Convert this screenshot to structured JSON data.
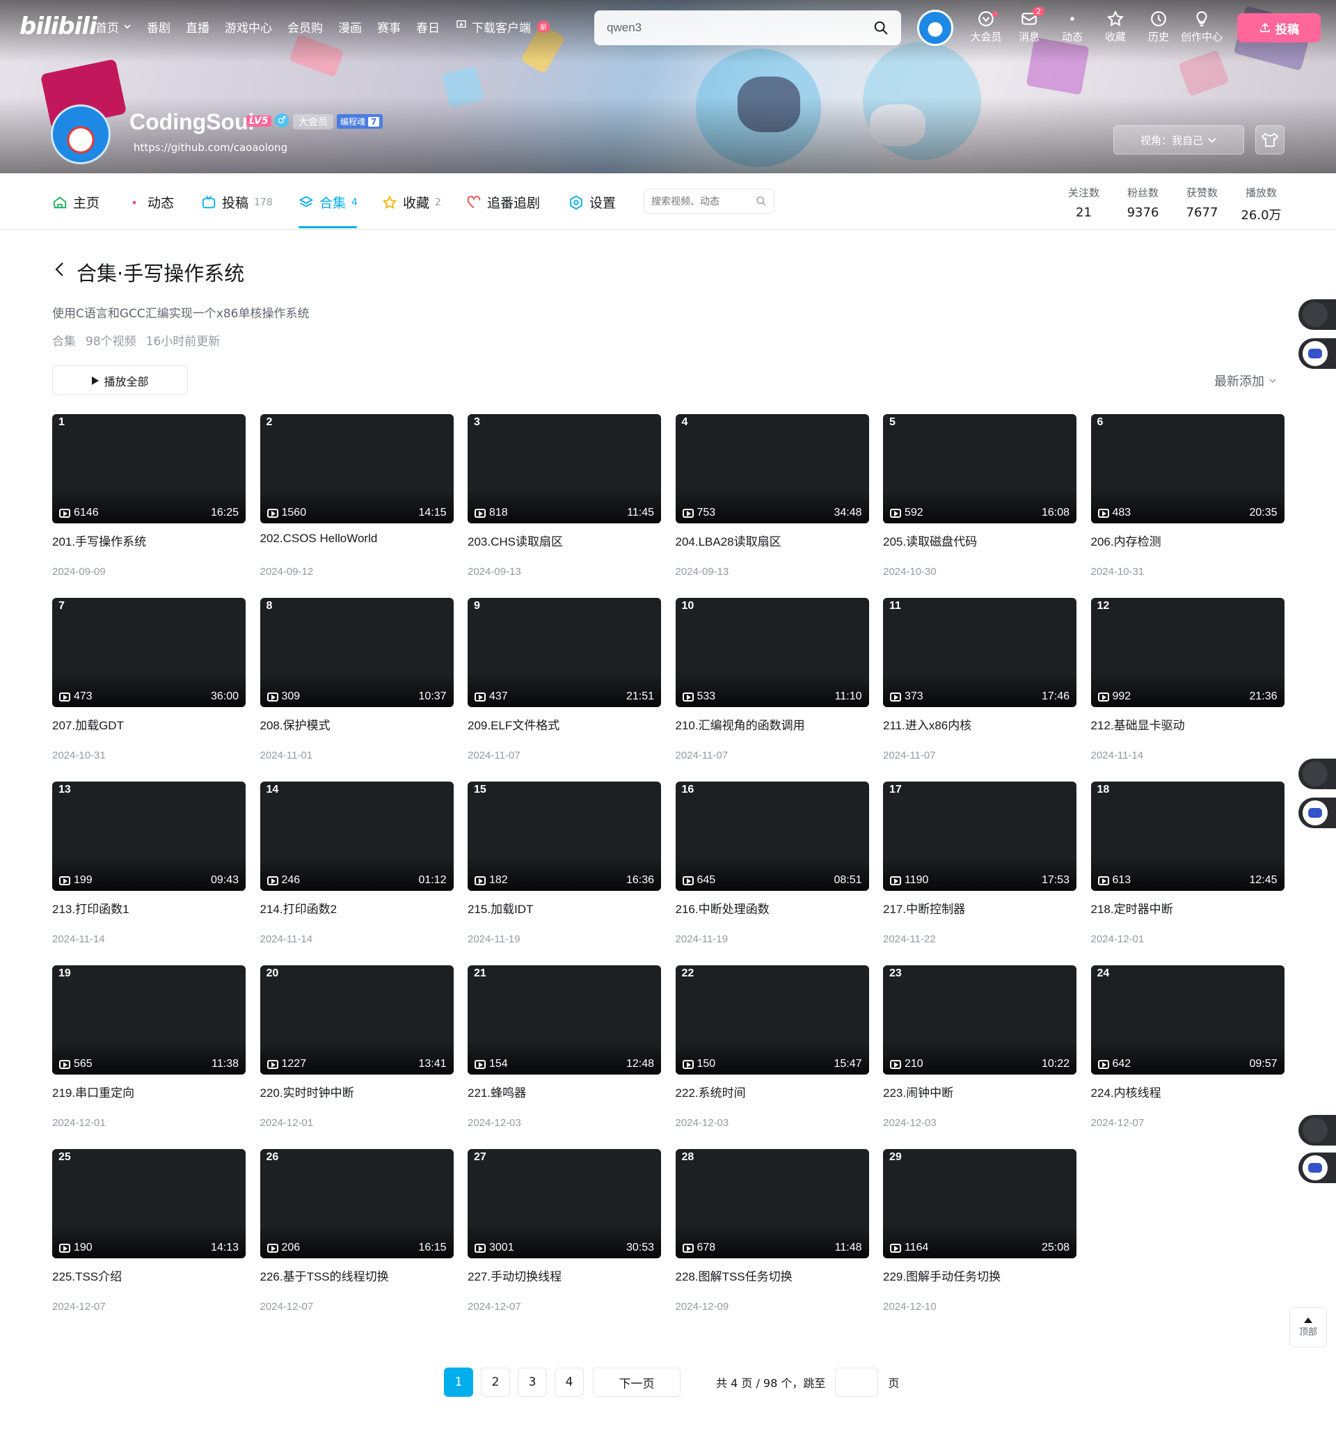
{
  "header": {
    "logo": "bilibili",
    "nav": [
      {
        "label": "首页",
        "has_chevron": true
      },
      {
        "label": "番剧"
      },
      {
        "label": "直播"
      },
      {
        "label": "游戏中心"
      },
      {
        "label": "会员购"
      },
      {
        "label": "漫画"
      },
      {
        "label": "赛事"
      },
      {
        "label": "春日"
      },
      {
        "label": "下载客户端",
        "badge": "新"
      }
    ],
    "search_value": "qwen3",
    "right": [
      {
        "label": "大会员",
        "icon": "vip-icon",
        "dot": true
      },
      {
        "label": "消息",
        "icon": "message-icon",
        "badge": "2"
      },
      {
        "label": "动态",
        "icon": "dynamic-icon"
      },
      {
        "label": "收藏",
        "icon": "star-icon"
      },
      {
        "label": "历史",
        "icon": "clock-icon"
      },
      {
        "label": "创作中心",
        "icon": "bulb-icon"
      }
    ],
    "upload_label": "投稿"
  },
  "profile": {
    "name": "CodingSoul",
    "level": "LV5",
    "vip": "大会员",
    "fan_badge": "编程魂",
    "fan_level": "7",
    "sign": "https://github.com/caoaolong",
    "view_as": "视角：我自己"
  },
  "tabs": [
    {
      "label": "主页",
      "count": "",
      "icon": "home-icon"
    },
    {
      "label": "动态",
      "count": "",
      "icon": "dynamic-icon"
    },
    {
      "label": "投稿",
      "count": "178",
      "icon": "tv-icon"
    },
    {
      "label": "合集",
      "count": "4",
      "icon": "layers-icon",
      "active": true
    },
    {
      "label": "收藏",
      "count": "2",
      "icon": "star-icon"
    },
    {
      "label": "追番追剧",
      "count": "",
      "icon": "heart-icon"
    },
    {
      "label": "设置",
      "count": "",
      "icon": "settings-icon"
    }
  ],
  "tab_search_placeholder": "搜索视频、动态",
  "stats": [
    {
      "label": "关注数",
      "value": "21"
    },
    {
      "label": "粉丝数",
      "value": "9376"
    },
    {
      "label": "获赞数",
      "value": "7677"
    },
    {
      "label": "播放数",
      "value": "26.0万"
    }
  ],
  "collection": {
    "title": "合集·手写操作系统",
    "description": "使用C语言和GCC汇编实现一个x86单核操作系统",
    "meta_type": "合集",
    "meta_count": "98个视频",
    "meta_updated": "16小时前更新",
    "play_all": "播放全部",
    "sort": "最新添加"
  },
  "videos": [
    {
      "idx": "1",
      "views": "6146",
      "duration": "16:25",
      "title": "201.手写操作系统",
      "date": "2024-09-09"
    },
    {
      "idx": "2",
      "views": "1560",
      "duration": "14:15",
      "title": "202.CSOS HelloWorld",
      "date": "2024-09-12"
    },
    {
      "idx": "3",
      "views": "818",
      "duration": "11:45",
      "title": "203.CHS读取扇区",
      "date": "2024-09-13"
    },
    {
      "idx": "4",
      "views": "753",
      "duration": "34:48",
      "title": "204.LBA28读取扇区",
      "date": "2024-09-13"
    },
    {
      "idx": "5",
      "views": "592",
      "duration": "16:08",
      "title": "205.读取磁盘代码",
      "date": "2024-10-30"
    },
    {
      "idx": "6",
      "views": "483",
      "duration": "20:35",
      "title": "206.内存检测",
      "date": "2024-10-31"
    },
    {
      "idx": "7",
      "views": "473",
      "duration": "36:00",
      "title": "207.加载GDT",
      "date": "2024-10-31"
    },
    {
      "idx": "8",
      "views": "309",
      "duration": "10:37",
      "title": "208.保护模式",
      "date": "2024-11-01"
    },
    {
      "idx": "9",
      "views": "437",
      "duration": "21:51",
      "title": "209.ELF文件格式",
      "date": "2024-11-07"
    },
    {
      "idx": "10",
      "views": "533",
      "duration": "11:10",
      "title": "210.汇编视角的函数调用",
      "date": "2024-11-07"
    },
    {
      "idx": "11",
      "views": "373",
      "duration": "17:46",
      "title": "211.进入x86内核",
      "date": "2024-11-07"
    },
    {
      "idx": "12",
      "views": "992",
      "duration": "21:36",
      "title": "212.基础显卡驱动",
      "date": "2024-11-14"
    },
    {
      "idx": "13",
      "views": "199",
      "duration": "09:43",
      "title": "213.打印函数1",
      "date": "2024-11-14"
    },
    {
      "idx": "14",
      "views": "246",
      "duration": "01:12",
      "title": "214.打印函数2",
      "date": "2024-11-14"
    },
    {
      "idx": "15",
      "views": "182",
      "duration": "16:36",
      "title": "215.加载IDT",
      "date": "2024-11-19"
    },
    {
      "idx": "16",
      "views": "645",
      "duration": "08:51",
      "title": "216.中断处理函数",
      "date": "2024-11-19"
    },
    {
      "idx": "17",
      "views": "1190",
      "duration": "17:53",
      "title": "217.中断控制器",
      "date": "2024-11-22"
    },
    {
      "idx": "18",
      "views": "613",
      "duration": "12:45",
      "title": "218.定时器中断",
      "date": "2024-12-01"
    },
    {
      "idx": "19",
      "views": "565",
      "duration": "11:38",
      "title": "219.串口重定向",
      "date": "2024-12-01"
    },
    {
      "idx": "20",
      "views": "1227",
      "duration": "13:41",
      "title": "220.实时时钟中断",
      "date": "2024-12-01"
    },
    {
      "idx": "21",
      "views": "154",
      "duration": "12:48",
      "title": "221.蜂鸣器",
      "date": "2024-12-03"
    },
    {
      "idx": "22",
      "views": "150",
      "duration": "15:47",
      "title": "222.系统时间",
      "date": "2024-12-03"
    },
    {
      "idx": "23",
      "views": "210",
      "duration": "10:22",
      "title": "223.闹钟中断",
      "date": "2024-12-03"
    },
    {
      "idx": "24",
      "views": "642",
      "duration": "09:57",
      "title": "224.内核线程",
      "date": "2024-12-07"
    },
    {
      "idx": "25",
      "views": "190",
      "duration": "14:13",
      "title": "225.TSS介绍",
      "date": "2024-12-07"
    },
    {
      "idx": "26",
      "views": "206",
      "duration": "16:15",
      "title": "226.基于TSS的线程切换",
      "date": "2024-12-07"
    },
    {
      "idx": "27",
      "views": "3001",
      "duration": "30:53",
      "title": "227.手动切换线程",
      "date": "2024-12-07"
    },
    {
      "idx": "28",
      "views": "678",
      "duration": "11:48",
      "title": "228.图解TSS任务切换",
      "date": "2024-12-09"
    },
    {
      "idx": "29",
      "views": "1164",
      "duration": "25:08",
      "title": "229.图解手动任务切换",
      "date": "2024-12-10"
    }
  ],
  "pagination": {
    "pages": [
      "1",
      "2",
      "3",
      "4"
    ],
    "current": "1",
    "next": "下一页",
    "info": "共 4 页 / 98 个，跳至",
    "suffix": "页"
  },
  "back_to_top": "顶部",
  "colors": {
    "accent": "#00aeec",
    "pink": "#ff6699",
    "text": "#18191c",
    "muted": "#9499a0"
  }
}
